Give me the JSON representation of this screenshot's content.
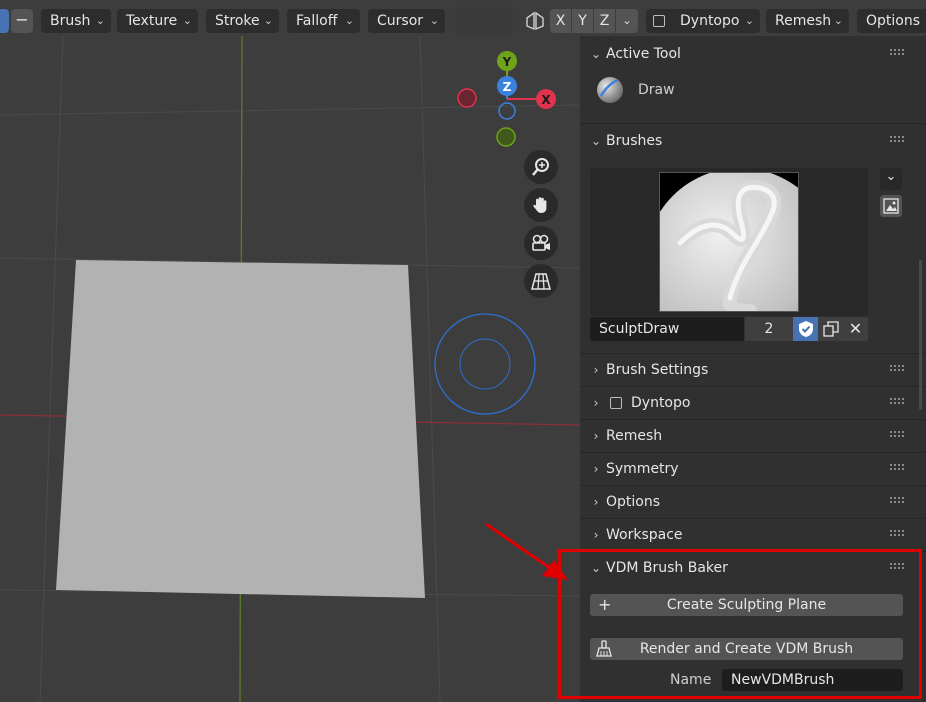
{
  "header": {
    "menus": [
      "Brush",
      "Texture",
      "Stroke",
      "Falloff",
      "Cursor"
    ],
    "axes": [
      "X",
      "Y",
      "Z"
    ],
    "dyntopo_label": "Dyntopo",
    "remesh_label": "Remesh",
    "options_label": "Options"
  },
  "gizmo": {
    "y": "Y",
    "z": "Z",
    "x": "X"
  },
  "sidebar": {
    "active_tool": {
      "title": "Active Tool",
      "tool_name": "Draw"
    },
    "brushes": {
      "title": "Brushes",
      "brush_name": "SculptDraw",
      "user_count": "2"
    },
    "panels": [
      {
        "label": "Brush Settings"
      },
      {
        "label": "Dyntopo"
      },
      {
        "label": "Remesh"
      },
      {
        "label": "Symmetry"
      },
      {
        "label": "Options"
      },
      {
        "label": "Workspace"
      }
    ],
    "vdm": {
      "title": "VDM Brush Baker",
      "create_plane_label": "Create Sculpting Plane",
      "render_label": "Render and Create VDM Brush",
      "name_label": "Name",
      "name_value": "NewVDMBrush"
    }
  },
  "colors": {
    "annotation": "#e00000",
    "x_axis": "#e0334d",
    "y_axis": "#6fa31a",
    "z_axis": "#3b82e0",
    "brush_cursor": "#2e6fd0",
    "highlight_blue": "#4772b3"
  }
}
